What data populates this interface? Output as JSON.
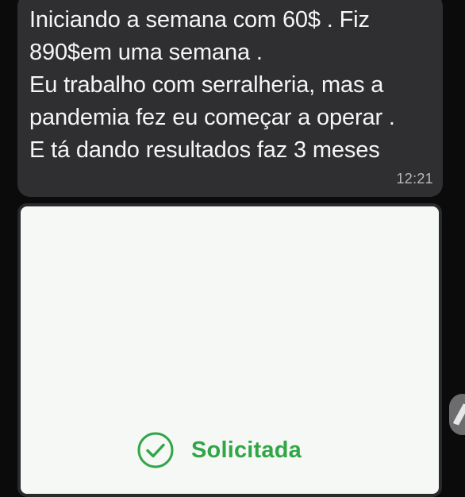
{
  "message": {
    "lines": [
      "Iniciando a semana com 60$ . Fiz",
      "890$em uma semana .",
      "Eu trabalho com serralheria, mas a",
      "pandemia fez eu começar a operar .",
      "E tá dando resultados faz 3 meses"
    ],
    "time": "12:21"
  },
  "receipt": {
    "status": "Solicitada",
    "status_color": "#31a646"
  },
  "icons": {
    "status": "check-circle-icon",
    "side": "pen-icon"
  },
  "colors": {
    "background": "#0b0b0b",
    "bubble": "#2f2f31",
    "card": "#f6f8f6",
    "text": "#f5f5f5",
    "time": "#b9b9bc"
  }
}
